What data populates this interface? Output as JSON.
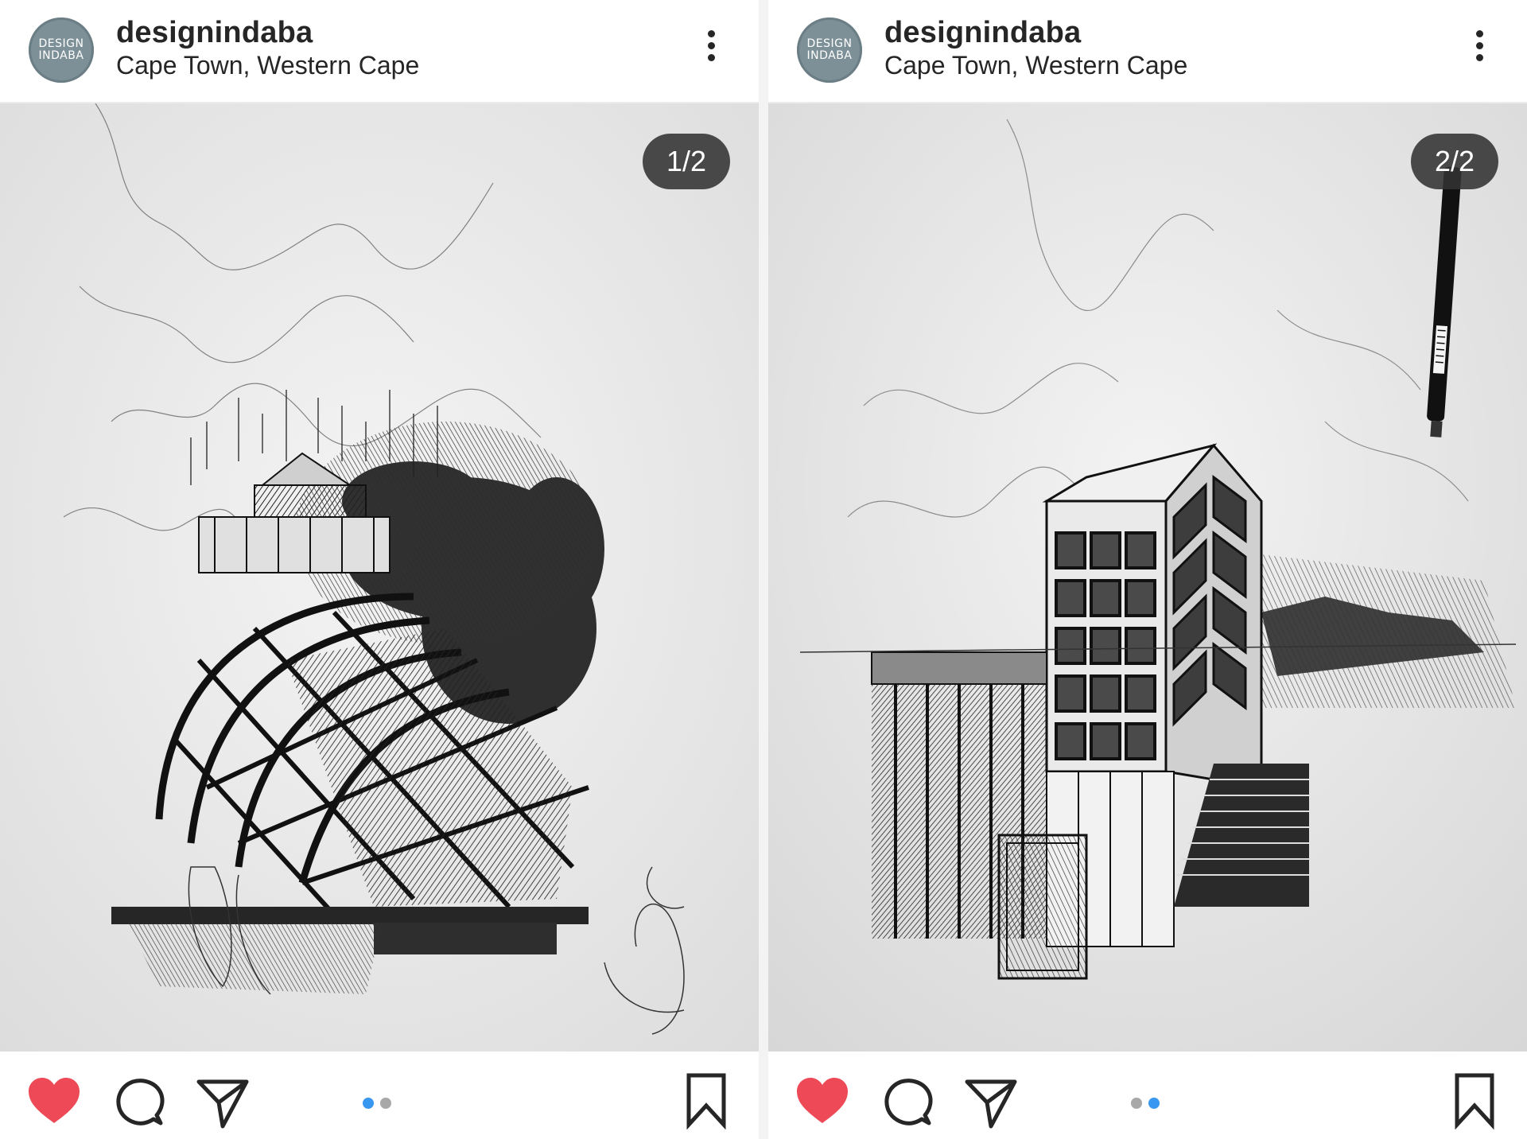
{
  "posts": [
    {
      "account": {
        "username": "designindaba",
        "location": "Cape Town, Western Cape",
        "avatar_line1": "DESIGN",
        "avatar_line2": "INDABA"
      },
      "media": {
        "counter": "1/2",
        "description_icon": "user-tag-icon"
      },
      "actions": {
        "liked": true,
        "like_icon": "heart-icon",
        "comment_icon": "comment-icon",
        "share_icon": "send-icon",
        "save_icon": "bookmark-icon"
      },
      "carousel": {
        "active": 1,
        "total": 2
      }
    },
    {
      "account": {
        "username": "designindaba",
        "location": "Cape Town, Western Cape",
        "avatar_line1": "DESIGN",
        "avatar_line2": "INDABA"
      },
      "media": {
        "counter": "2/2"
      },
      "actions": {
        "liked": true,
        "like_icon": "heart-icon",
        "comment_icon": "comment-icon",
        "share_icon": "send-icon",
        "save_icon": "bookmark-icon"
      },
      "carousel": {
        "active": 2,
        "total": 2
      }
    }
  ],
  "colors": {
    "heart": "#ed4956",
    "dot_active": "#3897f0",
    "dot_inactive": "#a8a8a8",
    "text": "#262626",
    "avatar": "#7d9097"
  }
}
